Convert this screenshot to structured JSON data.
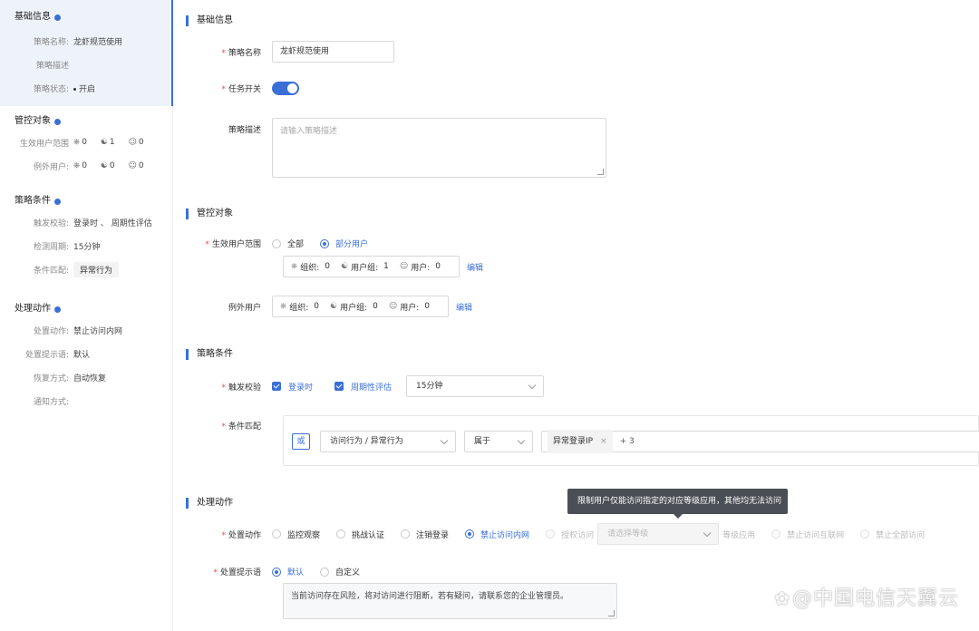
{
  "sidebar": {
    "basic": {
      "title": "基础信息",
      "rows": [
        {
          "label": "策略名称:",
          "value": "龙虾规范使用"
        },
        {
          "label": "策略描述",
          "value": ""
        },
        {
          "label": "策略状态:",
          "value": "开启"
        }
      ]
    },
    "target": {
      "title": "管控对象",
      "effective_label": "生效用户范围",
      "exclude_label": "例外用户:",
      "effective": {
        "org": "0",
        "group": "1",
        "user": "0"
      },
      "exclude": {
        "org": "0",
        "group": "0",
        "user": "0"
      }
    },
    "conditions": {
      "title": "策略条件",
      "rows": [
        {
          "label": "触发校验:",
          "value": "登录时 、 周期性评估"
        },
        {
          "label": "检测周期:",
          "value": "15分钟"
        },
        {
          "label": "条件匹配:",
          "value": "异常行为"
        }
      ]
    },
    "actions": {
      "title": "处理动作",
      "rows": [
        {
          "label": "处置动作:",
          "value": "禁止访问内网"
        },
        {
          "label": "处置提示语:",
          "value": "默认"
        },
        {
          "label": "恢复方式:",
          "value": "自动恢复"
        },
        {
          "label": "通知方式:",
          "value": ""
        }
      ]
    }
  },
  "form": {
    "basic": {
      "title": "基础信息",
      "name_label": "策略名称",
      "name_value": "龙虾规范使用",
      "switch_label": "任务开关",
      "switch_on": true,
      "desc_label": "策略描述",
      "desc_placeholder": "请输入策略描述"
    },
    "target": {
      "title": "管控对象",
      "scope_label": "生效用户范围",
      "scope_options": [
        "全部",
        "部分用户"
      ],
      "scope_selected": "部分用户",
      "effective_stats": {
        "org_label": "组织:",
        "org": "0",
        "group_label": "用户组:",
        "group": "1",
        "user_label": "用户:",
        "user": "0"
      },
      "edit_label": "编辑",
      "exclude_label": "例外用户",
      "exclude_stats": {
        "org_label": "组织:",
        "org": "0",
        "group_label": "用户组:",
        "group": "0",
        "user_label": "用户:",
        "user": "0"
      }
    },
    "conditions": {
      "title": "策略条件",
      "trigger_label": "触发校验",
      "trigger_options": [
        "登录时",
        "周期性评估"
      ],
      "period_value": "15分钟",
      "match_label": "条件匹配",
      "or_label": "或",
      "field_value": "访问行为 / 异常行为",
      "operator_value": "属于",
      "tag_value": "异常登录IP",
      "more_value": "+ 3"
    },
    "actions": {
      "title": "处理动作",
      "action_label": "处置动作",
      "action_options": [
        "监控观察",
        "挑战认证",
        "注销登录",
        "禁止访问内网",
        "授权访问"
      ],
      "action_selected": "禁止访问内网",
      "level_placeholder": "请选择等级",
      "level_suffix": "等级应用",
      "action_options_2": [
        "禁止访问互联网",
        "禁止全部访问"
      ],
      "tooltip": "限制用户仅能访问指定的对应等级应用，其他均无法访问",
      "prompt_label": "处置提示语",
      "prompt_options": [
        "默认",
        "自定义"
      ],
      "prompt_selected": "默认",
      "prompt_text": "当前访问存在风险，将对访问进行阻断，若有疑问，请联系您的企业管理员。"
    }
  },
  "watermark": "@中国电信天翼云"
}
